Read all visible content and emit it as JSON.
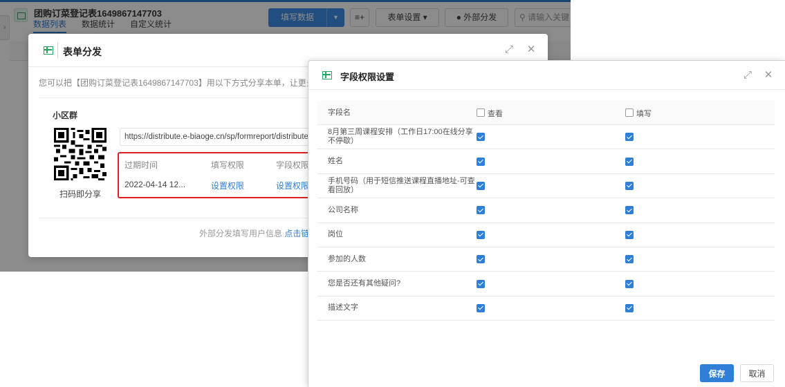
{
  "background_app": {
    "title": "团购订菜登记表1649867147703",
    "tabs": [
      "数据列表",
      "数据统计",
      "自定义统计"
    ],
    "fill_button_label": "填写数据",
    "view_toggle_icon": "≡+",
    "form_settings_label": "表单设置",
    "external_share_label": "外部分发",
    "search_placeholder": "请输入关键"
  },
  "share_modal": {
    "title": "表单分发",
    "intro": "您可以把【团购订菜登记表1649867147703】用以下方式分享本单，让更多人",
    "group_label": "小区群",
    "qr_caption": "扫码即分享",
    "url": "https://distribute.e-biaoge.cn/sp/formreport/distribute/T",
    "expire_header": "过期时间",
    "expire_value": "2022-04-14 12...",
    "fill_perm_header": "填写权限",
    "fill_perm_link": "设置权限",
    "field_perm_header": "字段权限",
    "field_perm_link": "设置权限",
    "footer_text": "外部分发填写用户信息",
    "footer_link": "点击链接"
  },
  "field_permission_modal": {
    "title": "字段权限设置",
    "col_field": "字段名",
    "col_view": "查看",
    "col_fill": "填写",
    "header_view_checked": false,
    "header_fill_checked": false,
    "rows": [
      {
        "name": "8月第三周课程安排（工作日17:00在线分享不停歇）",
        "view": true,
        "fill": true
      },
      {
        "name": "姓名",
        "view": true,
        "fill": true
      },
      {
        "name": "手机号码（用于短信推送课程直播地址-可查看回放）",
        "view": true,
        "fill": true
      },
      {
        "name": "公司名称",
        "view": true,
        "fill": true
      },
      {
        "name": "岗位",
        "view": true,
        "fill": true
      },
      {
        "name": "参加的人数",
        "view": true,
        "fill": true
      },
      {
        "name": "您是否还有其他疑问?",
        "view": true,
        "fill": true
      },
      {
        "name": "描述文字",
        "view": true,
        "fill": true
      }
    ],
    "save_label": "保存",
    "cancel_label": "取消"
  }
}
